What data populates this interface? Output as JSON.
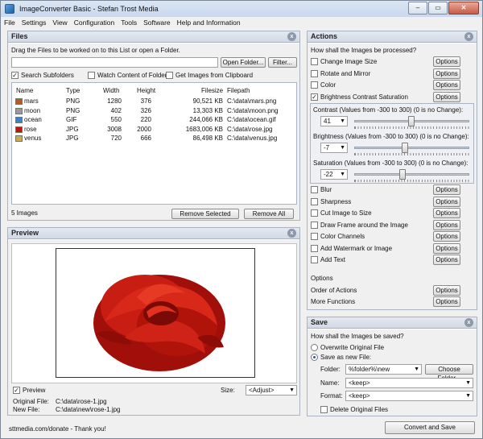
{
  "window": {
    "title": "ImageConverter Basic - Stefan Trost Media",
    "min": "–",
    "max": "▭",
    "close": "✕"
  },
  "menu": [
    "File",
    "Settings",
    "View",
    "Configuration",
    "Tools",
    "Software",
    "Help and Information"
  ],
  "files": {
    "header": "Files",
    "close": "x",
    "hint": "Drag the Files to be worked on to this List or open a Folder.",
    "path_value": "",
    "open_folder": "Open Folder...",
    "filter": "Filter...",
    "search_subfolders": "Search Subfolders",
    "watch_folder": "Watch Content of Folder",
    "clipboard": "Get Images from Clipboard",
    "columns": [
      "Name",
      "Type",
      "Width",
      "Height",
      "Filesize",
      "Filepath"
    ],
    "rows": [
      {
        "name": "mars",
        "type": "PNG",
        "width": "1280",
        "height": "376",
        "size": "90,521 KB",
        "path": "C:\\data\\mars.png",
        "color": "#b05a2e"
      },
      {
        "name": "moon",
        "type": "PNG",
        "width": "402",
        "height": "326",
        "size": "13,303 KB",
        "path": "C:\\data\\moon.png",
        "color": "#9a9a9a"
      },
      {
        "name": "ocean",
        "type": "GIF",
        "width": "550",
        "height": "220",
        "size": "244,066 KB",
        "path": "C:\\data\\ocean.gif",
        "color": "#3f82c4"
      },
      {
        "name": "rose",
        "type": "JPG",
        "width": "3008",
        "height": "2000",
        "size": "1683,006 KB",
        "path": "C:\\data\\rose.jpg",
        "color": "#b31a12"
      },
      {
        "name": "venus",
        "type": "JPG",
        "width": "720",
        "height": "666",
        "size": "86,498 KB",
        "path": "C:\\data\\venus.jpg",
        "color": "#c9a95a"
      }
    ],
    "count": "5 Images",
    "remove_selected": "Remove Selected",
    "remove_all": "Remove All"
  },
  "preview": {
    "header": "Preview",
    "close": "x",
    "preview_label": "Preview",
    "size_label": "Size:",
    "size_value": "<Adjust>",
    "original_label": "Original File:",
    "original_value": "C:\\data\\rose-1.jpg",
    "new_label": "New File:",
    "new_value": "C:\\data\\new\\rose-1.jpg"
  },
  "actions": {
    "header": "Actions",
    "close": "x",
    "question": "How shall the Images be processed?",
    "options": "Options",
    "top": [
      {
        "label": "Change Image Size",
        "checked": false
      },
      {
        "label": "Rotate and Mirror",
        "checked": false
      },
      {
        "label": "Color",
        "checked": false
      },
      {
        "label": "Brightness Contrast Saturation",
        "checked": true
      }
    ],
    "contrast": {
      "label": "Contrast (Values from -300 to 300) (0 is no Change):",
      "value": "41"
    },
    "brightness": {
      "label": "Brightness (Values from -300 to 300) (0 is no Change):",
      "value": "-7"
    },
    "saturation": {
      "label": "Saturation (Values from -300 to 300) (0 is no Change):",
      "value": "-22"
    },
    "bottom": [
      {
        "label": "Blur"
      },
      {
        "label": "Sharpness"
      },
      {
        "label": "Cut Image to Size"
      },
      {
        "label": "Draw Frame around the Image"
      },
      {
        "label": "Color Channels"
      },
      {
        "label": "Add Watermark or Image"
      },
      {
        "label": "Add Text"
      }
    ],
    "options_title": "Options",
    "order": "Order of Actions",
    "more": "More Functions"
  },
  "save": {
    "header": "Save",
    "close": "x",
    "question": "How shall the Images be saved?",
    "overwrite": "Overwrite Original File",
    "save_new": "Save as new File:",
    "folder_label": "Folder:",
    "folder_value": "%folder%\\new",
    "choose_folder": "Choose Folder...",
    "name_label": "Name:",
    "name_value": "<keep>",
    "format_label": "Format:",
    "format_value": "<keep>",
    "delete": "Delete Original Files"
  },
  "status": {
    "donate": "sttmedia.com/donate - Thank you!",
    "convert": "Convert and Save"
  }
}
